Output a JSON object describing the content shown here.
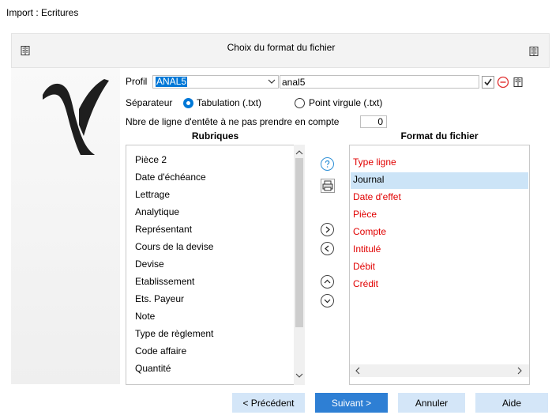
{
  "window_title": "Import : Ecritures",
  "header": {
    "title": "Choix du format du fichier"
  },
  "form": {
    "profil_label": "Profil",
    "profil_value": "ANAL5",
    "profil_name_value": "anal5",
    "separateur_label": "Séparateur",
    "radio_tab_label": "Tabulation (.txt)",
    "radio_semicolon_label": "Point virgule (.txt)",
    "header_lines_label": "Nbre de ligne d'entête à ne pas prendre en compte",
    "header_lines_value": "0"
  },
  "rubriques": {
    "title": "Rubriques",
    "items": [
      "Pièce 2",
      "Date d'échéance",
      "Lettrage",
      "Analytique",
      "Représentant",
      "Cours de la devise",
      "Devise",
      "Etablissement",
      "Ets. Payeur",
      "Note",
      "Type de règlement",
      "Code affaire",
      "Quantité"
    ]
  },
  "format": {
    "title": "Format du fichier",
    "items": [
      {
        "label": "Type ligne",
        "color": "#e10000"
      },
      {
        "label": "Journal",
        "color": "#000000"
      },
      {
        "label": "Date d'effet",
        "color": "#e10000"
      },
      {
        "label": "Pièce",
        "color": "#e10000"
      },
      {
        "label": "Compte",
        "color": "#e10000"
      },
      {
        "label": "Intitulé",
        "color": "#e10000"
      },
      {
        "label": "Débit",
        "color": "#e10000"
      },
      {
        "label": "Crédit",
        "color": "#e10000"
      }
    ],
    "selected_index": 1
  },
  "footer": {
    "prev_label": "< Précédent",
    "next_label": "Suivant >",
    "cancel_label": "Annuler",
    "help_label": "Aide"
  },
  "colors": {
    "accent": "#0078d7",
    "required": "#e10000",
    "primary_button": "#2e7fd4",
    "secondary_button": "#d4e6f8"
  }
}
